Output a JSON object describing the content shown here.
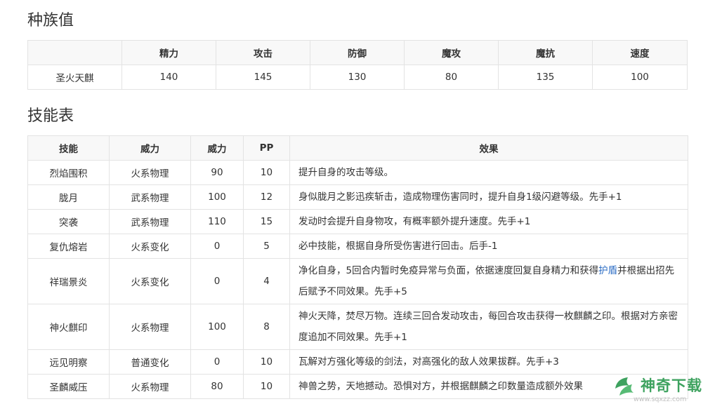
{
  "stats": {
    "title": "种族值",
    "headers": [
      "",
      "精力",
      "攻击",
      "防御",
      "魔攻",
      "魔抗",
      "速度"
    ],
    "row": [
      "圣火天麒",
      "140",
      "145",
      "130",
      "80",
      "135",
      "100"
    ]
  },
  "skills": {
    "title": "技能表",
    "headers": [
      "技能",
      "威力",
      "威力",
      "PP",
      "效果"
    ],
    "rows": [
      {
        "name": "烈焰围积",
        "type": "火系物理",
        "power": "90",
        "pp": "10",
        "effect": "提升自身的攻击等级。"
      },
      {
        "name": "胧月",
        "type": "武系物理",
        "power": "100",
        "pp": "12",
        "effect": "身似胧月之影迅疾斩击，造成物理伤害同时，提升自身1级闪避等级。先手+1"
      },
      {
        "name": "突袭",
        "type": "武系物理",
        "power": "110",
        "pp": "15",
        "effect": "发动时会提升自身物攻，有概率额外提升速度。先手+1"
      },
      {
        "name": "复仇熔岩",
        "type": "火系变化",
        "power": "0",
        "pp": "5",
        "effect": "必中技能，根据自身所受伤害进行回击。后手-1"
      },
      {
        "name": "祥瑞景炎",
        "type": "火系变化",
        "power": "0",
        "pp": "4",
        "effect_pre": "净化自身，5回合内暂时免疫异常与负面，依据速度回复自身精力和获得",
        "effect_link": "护盾",
        "effect_post": "并根据出招先后赋予不同效果。先手+5"
      },
      {
        "name": "神火麒印",
        "type": "火系物理",
        "power": "100",
        "pp": "8",
        "effect": "神火天降，焚尽万物。连续三回合发动攻击，每回合攻击获得一枚麒麟之印。根据对方亲密度追加不同效果。先手+1"
      },
      {
        "name": "远见明察",
        "type": "普通变化",
        "power": "0",
        "pp": "10",
        "effect": "瓦解对方强化等级的剑法，对高强化的敌人效果拔群。先手+3"
      },
      {
        "name": "圣麟威压",
        "type": "火系物理",
        "power": "80",
        "pp": "10",
        "effect": "神兽之势，天地撼动。恐惧对方，并根据麒麟之印数量造成额外效果"
      }
    ]
  },
  "watermark": {
    "text": "神奇下载",
    "url": "www.sqxzz.com",
    "color": "#2e9b52",
    "icon": "leaf-logo-icon"
  }
}
